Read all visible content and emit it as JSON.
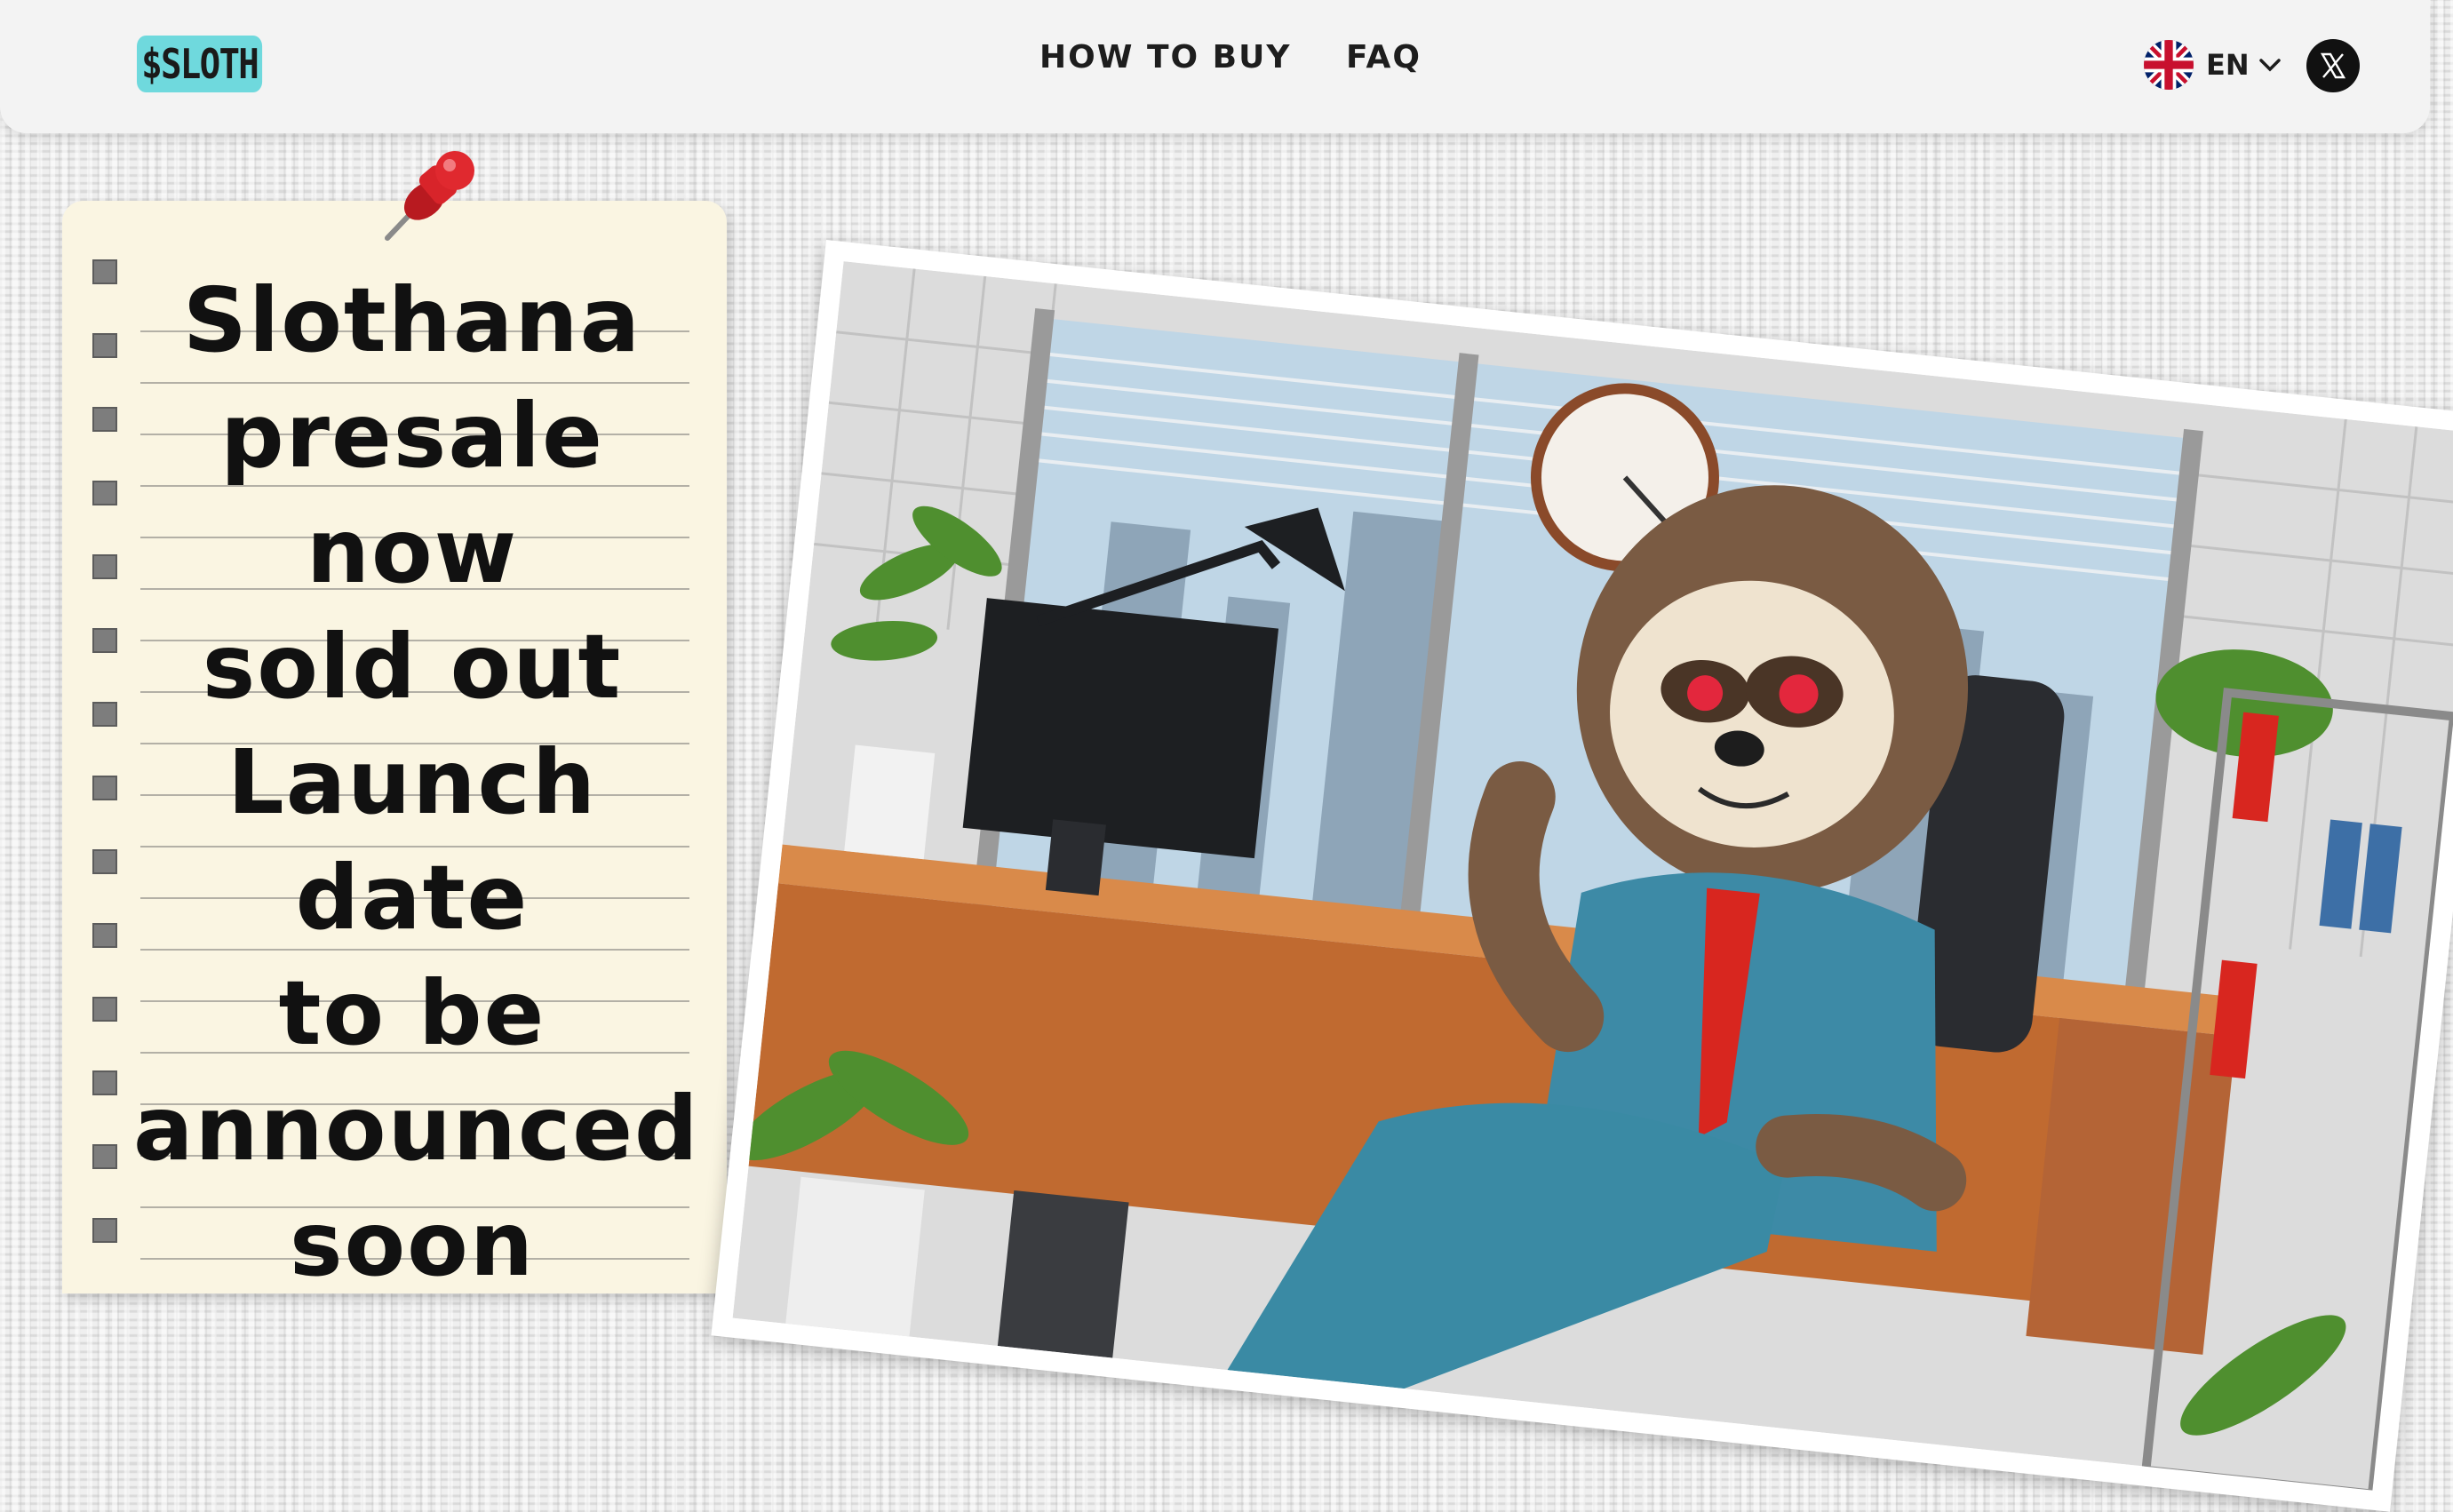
{
  "header": {
    "logo_text": "$SLOTH",
    "nav": [
      {
        "label": "HOW TO BUY"
      },
      {
        "label": "FAQ"
      }
    ],
    "language": {
      "code": "EN",
      "flag": "uk-flag-icon"
    },
    "social": {
      "icon": "x-twitter-icon"
    }
  },
  "note": {
    "lines": [
      "Slothana",
      "presale now",
      "sold out",
      "Launch date",
      "to be",
      "announced",
      "soon"
    ]
  },
  "colors": {
    "logo_bg": "#6fd9dd",
    "note_paper": "#faf5e2",
    "pin_red": "#d8242a",
    "suit": "#3d8aa6",
    "tie": "#d8261f"
  }
}
